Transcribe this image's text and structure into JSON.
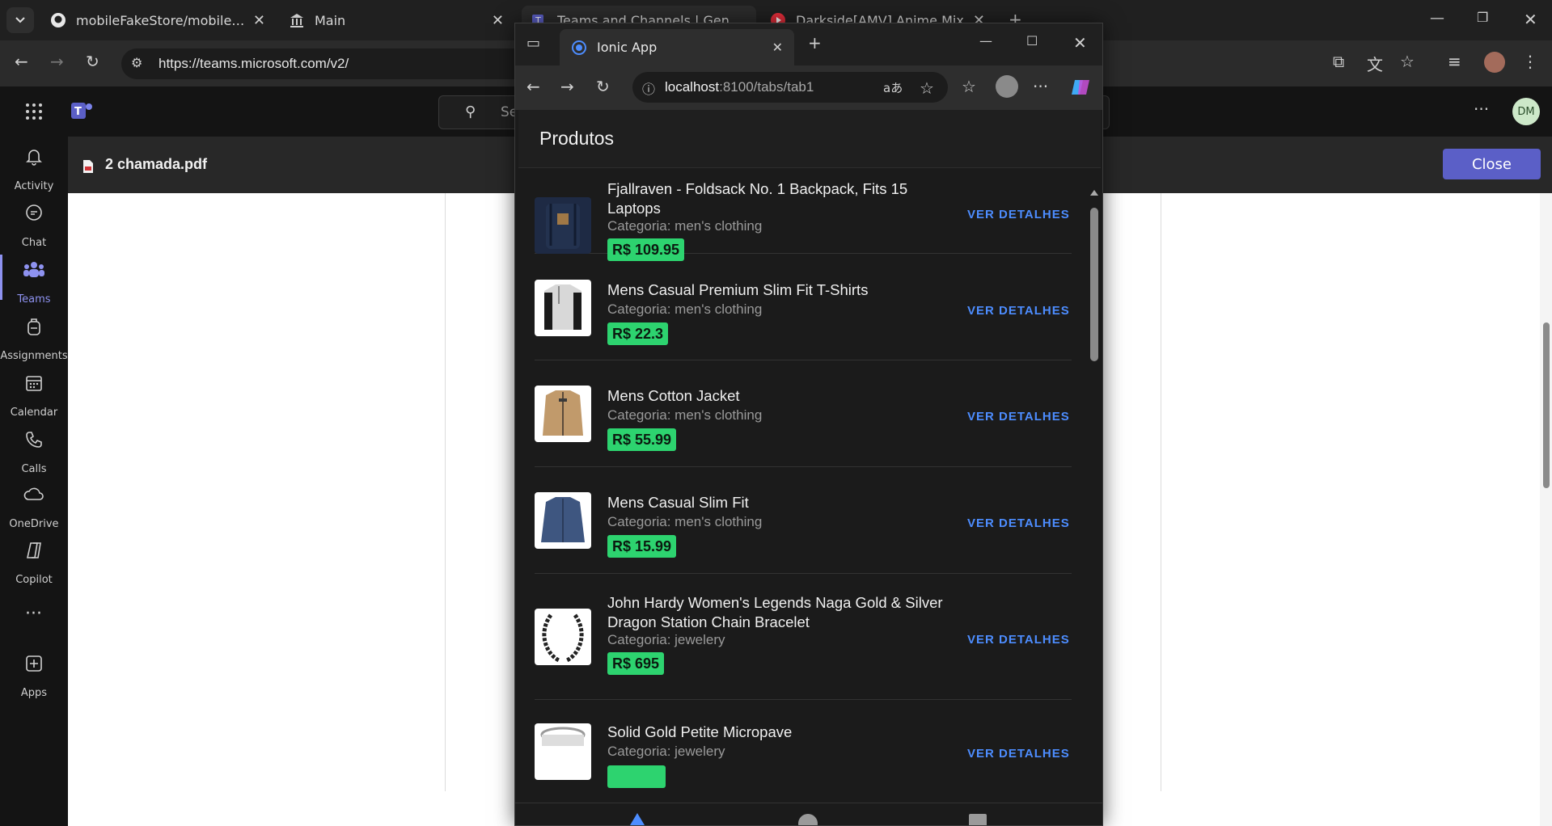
{
  "outer_browser": {
    "tabs": [
      {
        "title": "mobileFakeStore/mobileFakeSto",
        "icon": "github-icon"
      },
      {
        "title": "Main",
        "icon": "bank-icon"
      },
      {
        "title": "Teams and Channels | General |",
        "icon": "teams-icon"
      },
      {
        "title": "Darkside[AMV] Anime Mix",
        "icon": "youtube-icon"
      }
    ],
    "url": "https://teams.microsoft.com/v2/"
  },
  "teams": {
    "search_placeholder": "Se",
    "rail": [
      {
        "label": "Activity",
        "icon": "bell-icon"
      },
      {
        "label": "Chat",
        "icon": "chat-icon"
      },
      {
        "label": "Teams",
        "icon": "teams-people-icon"
      },
      {
        "label": "Assignments",
        "icon": "backpack-icon"
      },
      {
        "label": "Calendar",
        "icon": "calendar-icon"
      },
      {
        "label": "Calls",
        "icon": "phone-icon"
      },
      {
        "label": "OneDrive",
        "icon": "cloud-icon"
      },
      {
        "label": "Copilot",
        "icon": "copilot-icon"
      },
      {
        "label": "Apps",
        "icon": "plus-square-icon"
      }
    ],
    "document_name": "2 chamada.pdf",
    "close_label": "Close",
    "avatar_initials": "DM"
  },
  "popup": {
    "tab_title": "Ionic App",
    "url_host": "localhost",
    "url_rest": ":8100/tabs/tab1",
    "page_title": "Produtos",
    "details_label": "VER DETALHES",
    "products": [
      {
        "title": "Fjallraven - Foldsack No. 1 Backpack, Fits 15 Laptops",
        "category": "Categoria: men's clothing",
        "price": "R$ 109.95"
      },
      {
        "title": "Mens Casual Premium Slim Fit T-Shirts",
        "category": "Categoria: men's clothing",
        "price": "R$ 22.3"
      },
      {
        "title": "Mens Cotton Jacket",
        "category": "Categoria: men's clothing",
        "price": "R$ 55.99"
      },
      {
        "title": "Mens Casual Slim Fit",
        "category": "Categoria: men's clothing",
        "price": "R$ 15.99"
      },
      {
        "title": "John Hardy Women's Legends Naga Gold & Silver Dragon Station Chain Bracelet",
        "category": "Categoria: jewelery",
        "price": "R$ 695"
      },
      {
        "title": "Solid Gold Petite Micropave",
        "category": "Categoria: jewelery",
        "price": ""
      }
    ]
  },
  "colors": {
    "accent": "#5b5fc7",
    "price_badge": "#2dd36f",
    "details_link": "#4d8dff"
  }
}
